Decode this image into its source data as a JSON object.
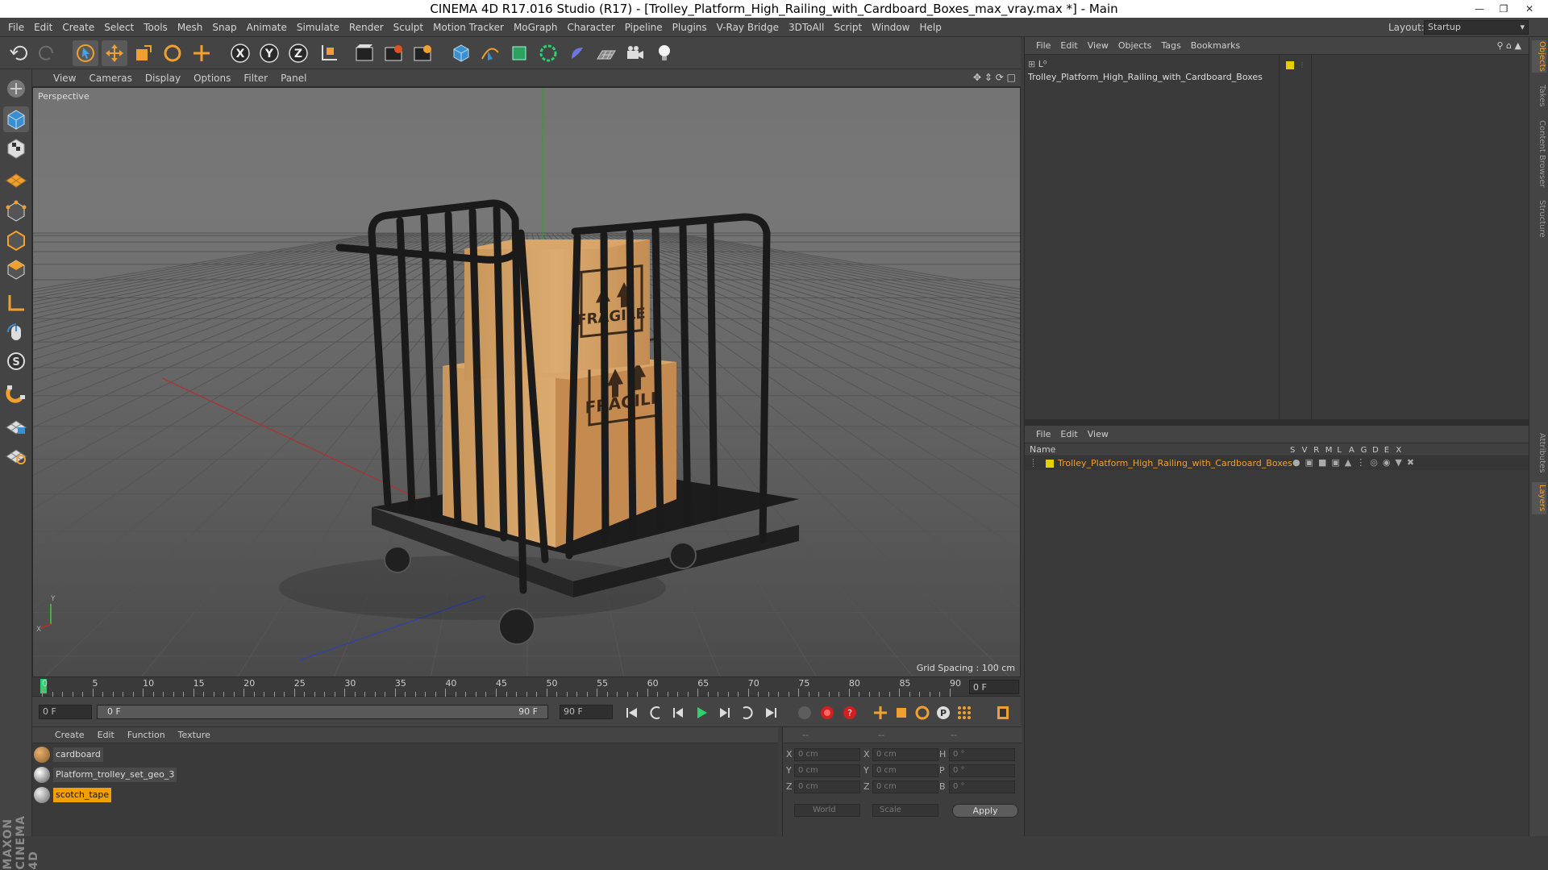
{
  "window": {
    "title": "CINEMA 4D R17.016 Studio (R17) - [Trolley_Platform_High_Railing_with_Cardboard_Boxes_max_vray.max *] - Main",
    "layout_label": "Layout:",
    "layout_value": "Startup"
  },
  "menubar": [
    "File",
    "Edit",
    "Create",
    "Select",
    "Tools",
    "Mesh",
    "Snap",
    "Animate",
    "Simulate",
    "Render",
    "Sculpt",
    "Motion Tracker",
    "MoGraph",
    "Character",
    "Pipeline",
    "Plugins",
    "V-Ray Bridge",
    "3DToAll",
    "Script",
    "Window",
    "Help"
  ],
  "toolbar": {
    "icons": [
      "undo-icon",
      "redo-icon",
      "live-select-icon",
      "move-icon",
      "scale-icon",
      "rotate-icon",
      "move-axis-icon",
      "x-axis-icon",
      "y-axis-icon",
      "z-axis-icon",
      "coordinate-system-icon",
      "render-view-icon",
      "render-picture-viewer-icon",
      "edit-render-settings-icon",
      "cube-icon",
      "pen-spline-icon",
      "nurbs-icon",
      "array-icon",
      "deformer-icon",
      "floor-icon",
      "camera-icon",
      "light-icon"
    ],
    "axis_letters": [
      "X",
      "Y",
      "Z"
    ]
  },
  "viewport": {
    "menu": [
      "View",
      "Cameras",
      "Display",
      "Options",
      "Filter",
      "Panel"
    ],
    "label": "Perspective",
    "grid_spacing": "Grid Spacing : 100 cm",
    "box_text": "FRAGILE"
  },
  "timeline": {
    "ticks": [
      "0",
      "5",
      "10",
      "15",
      "20",
      "25",
      "30",
      "35",
      "40",
      "45",
      "50",
      "55",
      "60",
      "65",
      "70",
      "75",
      "80",
      "85",
      "90"
    ],
    "current_frame": "0 F",
    "start_frame": "0 F",
    "range_start": "0 F",
    "range_end": "90 F",
    "end_frame": "90 F"
  },
  "materials": {
    "menu": [
      "Create",
      "Edit",
      "Function",
      "Texture"
    ],
    "items": [
      {
        "name": "cardboard",
        "selected": false
      },
      {
        "name": "Platform_trolley_set_geo_3",
        "selected": false
      },
      {
        "name": "scotch_tape",
        "selected": true
      }
    ]
  },
  "coordinates": {
    "headers": [
      "--",
      "--",
      "--"
    ],
    "rows": [
      {
        "a": "X",
        "av": "0 cm",
        "b": "X",
        "bv": "0 cm",
        "c": "H",
        "cv": "0 °"
      },
      {
        "a": "Y",
        "av": "0 cm",
        "b": "Y",
        "bv": "0 cm",
        "c": "P",
        "cv": "0 °"
      },
      {
        "a": "Z",
        "av": "0 cm",
        "b": "Z",
        "bv": "0 cm",
        "c": "B",
        "cv": "0 °"
      }
    ],
    "world": "World",
    "scale": "Scale",
    "apply": "Apply"
  },
  "objects_panel": {
    "menu": [
      "File",
      "Edit",
      "View",
      "Objects",
      "Tags",
      "Bookmarks"
    ],
    "root": "Trolley_Platform_High_Railing_with_Cardboard_Boxes"
  },
  "layers_panel": {
    "menu": [
      "File",
      "Edit",
      "View"
    ],
    "name_header": "Name",
    "columns": [
      "S",
      "V",
      "R",
      "M",
      "L",
      "A",
      "G",
      "D",
      "E",
      "X"
    ],
    "layer": "Trolley_Platform_High_Railing_with_Cardboard_Boxes"
  },
  "side_tabs": [
    "Objects",
    "Takes",
    "Content Browser",
    "Structure",
    "Attributes",
    "Layers"
  ],
  "brand": "MAXON CINEMA 4D",
  "colors": {
    "accent": "#f0a030",
    "selection": "#e8a000",
    "layer_yellow": "#e8d000"
  }
}
